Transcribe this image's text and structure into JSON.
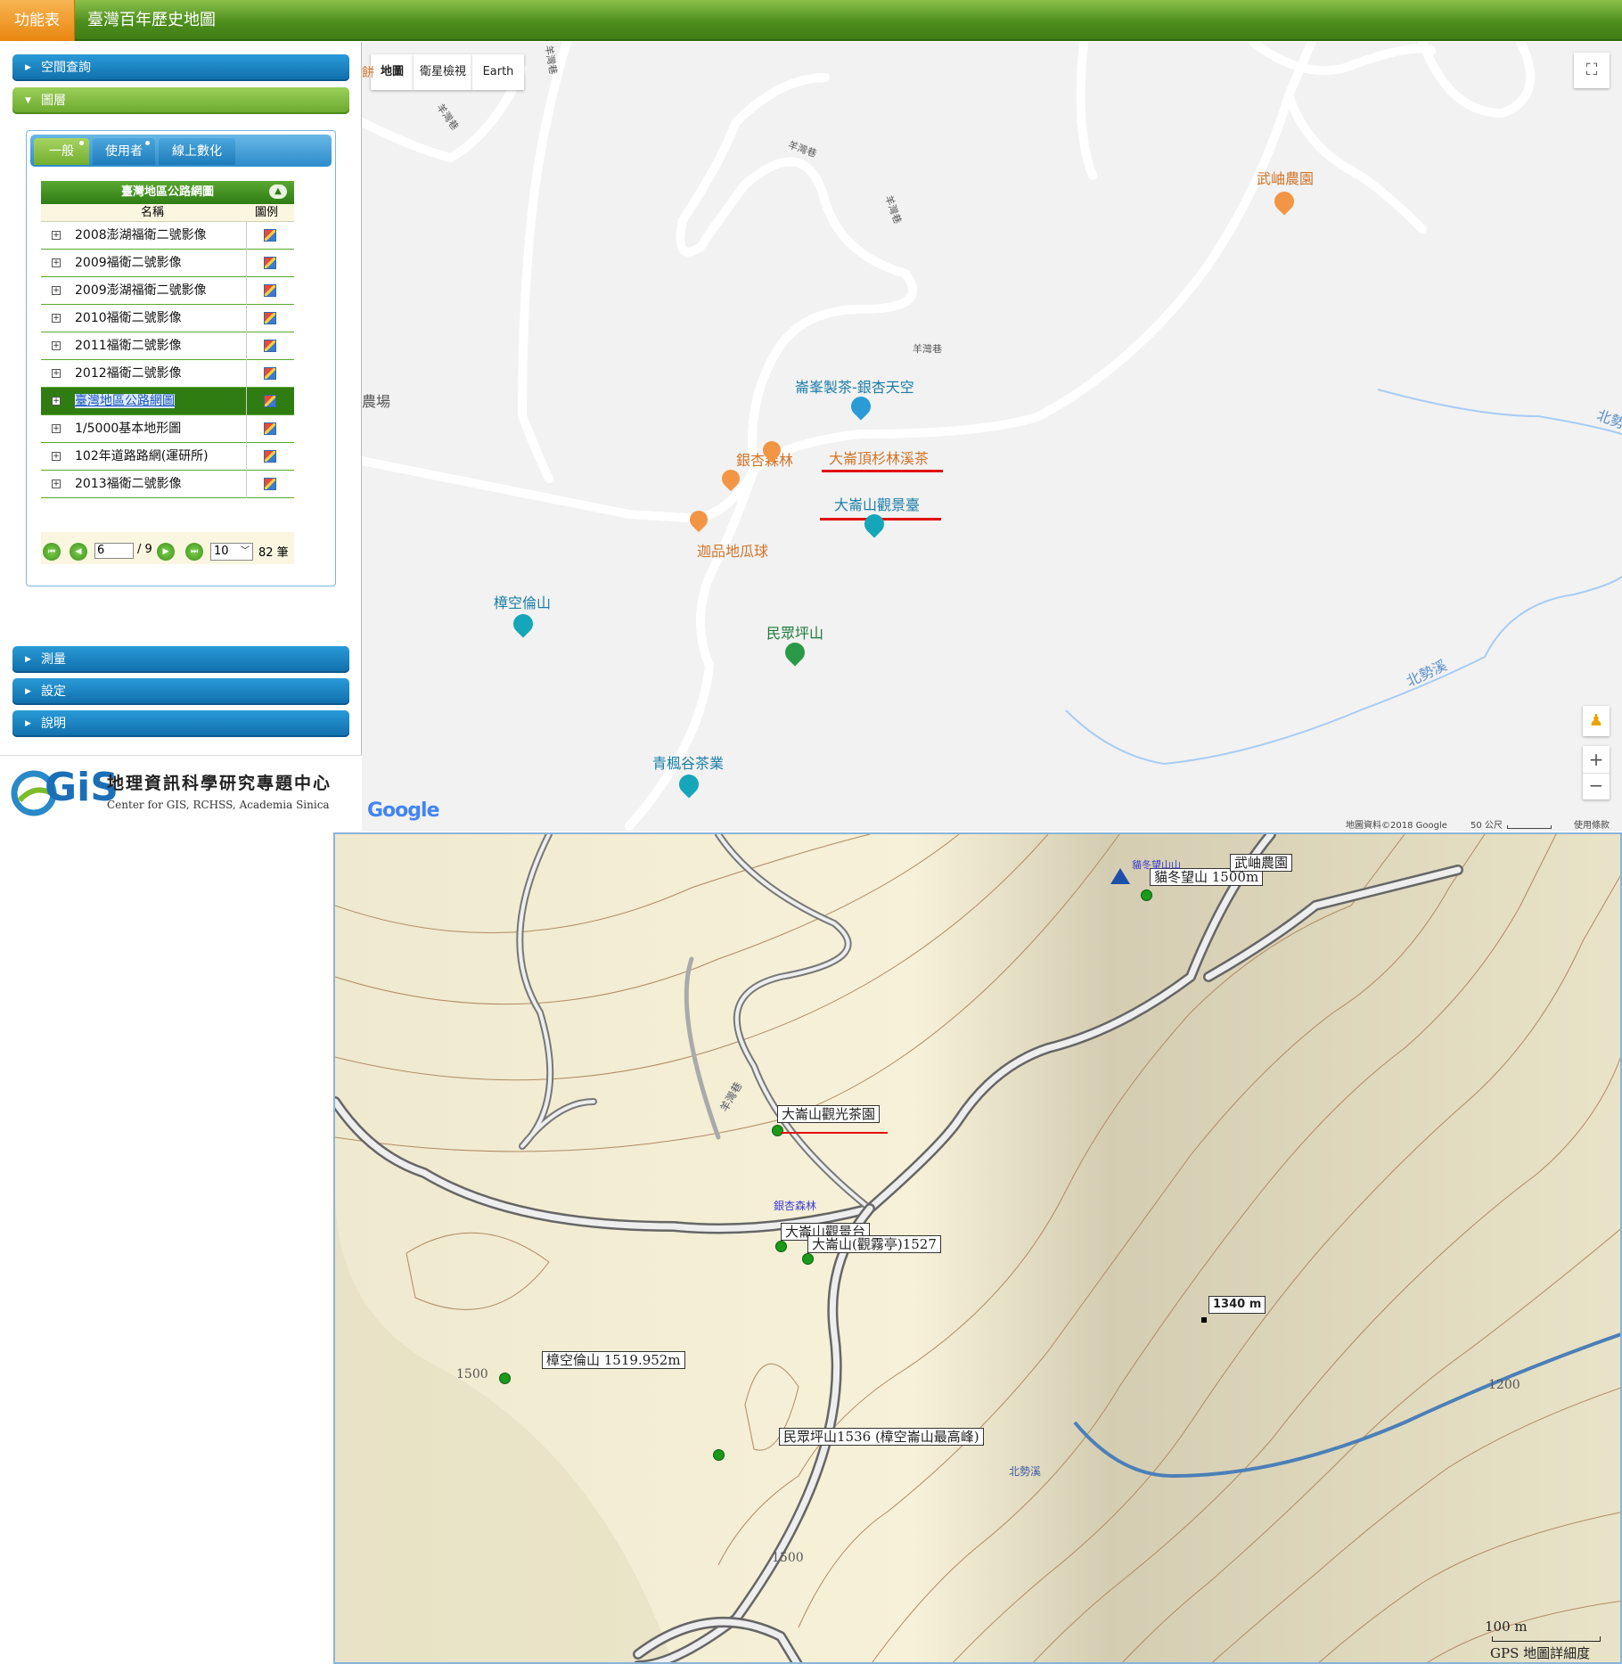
{
  "topbar": {
    "menu_label": "功能表",
    "title": "臺灣百年歷史地圖"
  },
  "sidebar": {
    "sections": {
      "spatial_query": "空間查詢",
      "layers": "圖層",
      "measure": "測量",
      "settings": "設定",
      "help": "說明"
    },
    "tabs": [
      "一般",
      "使用者",
      "線上數化"
    ],
    "table": {
      "title": "臺灣地區公路網圖",
      "col_name": "名稱",
      "col_legend": "圖例",
      "rows": [
        "2008澎湖福衛二號影像",
        "2009福衛二號影像",
        "2009澎湖福衛二號影像",
        "2010福衛二號影像",
        "2011福衛二號影像",
        "2012福衛二號影像",
        "臺灣地區公路網圖",
        "1/5000基本地形圖",
        "102年道路路網(運研所)",
        "2013福衛二號影像"
      ]
    },
    "pager": {
      "page": "6",
      "total": "/ 9",
      "per_page": "10",
      "count": "82 筆"
    }
  },
  "logo": {
    "mark": "GiS",
    "title": "地理資訊科學研究專題中心",
    "subtitle": "Center for GIS, RCHSS, Academia Sinica"
  },
  "google_map": {
    "map_types": [
      "地圖",
      "衛星檢視",
      "Earth"
    ],
    "labels": {
      "p1": "崙峯製茶-銀杏天空",
      "p2": "銀杏森林",
      "p3": "大崙頂杉林溪茶",
      "p4": "大崙山觀景臺",
      "p5": "迦品地瓜球",
      "p6": "樟空倫山",
      "p7": "民眾坪山",
      "p8": "青楓谷茶業",
      "p9": "武岫農園",
      "p10": "北勢溪",
      "p11": "北勢",
      "p12": "農場",
      "p13": "餅"
    },
    "roads": [
      "羊灣巷",
      "羊灣巷",
      "羊灣巷",
      "羊灣巷",
      "羊灣巷"
    ],
    "brand": "Google",
    "attribution": "地圖資料©2018 Google",
    "scale": "50 公尺",
    "terms": "使用條款",
    "zoom_in": "+",
    "zoom_out": "−"
  },
  "gps_map": {
    "labels": {
      "l1": "大崙山觀光茶園",
      "l2": "大崙山觀景台",
      "l3": "大崙山(觀霧亭)1527",
      "l4": "樟空倫山 1519.952m",
      "l5": "民眾坪山1536 (樟空崙山最高峰)",
      "l6": "貓冬望山 1500m",
      "l7": "武岫農園",
      "l8": "1340 m"
    },
    "small": {
      "s1": "羊灣巷",
      "s2": "銀杏森林",
      "s3": "北勢溪",
      "s4": "貓冬望山山",
      "c1": "1500",
      "c2": "1500",
      "c3": "1200"
    },
    "scale": "100 m",
    "detail": "GPS 地圖詳細度"
  }
}
